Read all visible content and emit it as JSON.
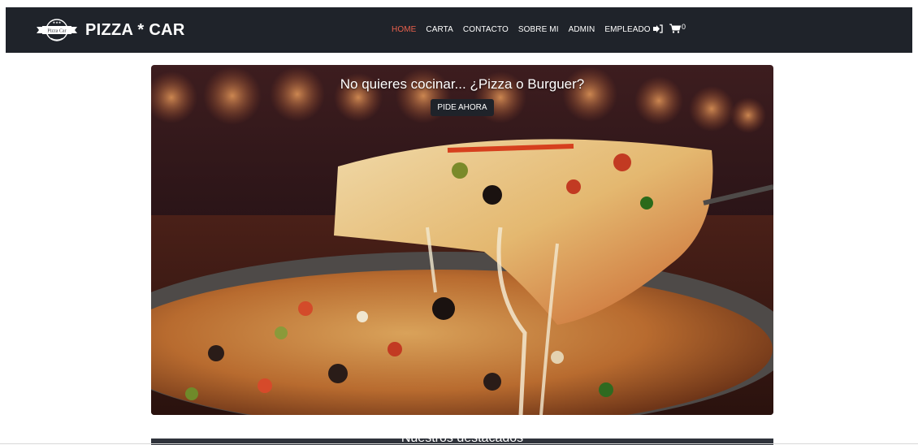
{
  "navbar": {
    "brand_name": "PIZZA * CAR",
    "logo_text": "Pizza Car",
    "links": [
      {
        "label": "HOME",
        "active": true
      },
      {
        "label": "CARTA",
        "active": false
      },
      {
        "label": "CONTACTO",
        "active": false
      },
      {
        "label": "SOBRE MI",
        "active": false
      },
      {
        "label": "ADMIN",
        "active": false
      },
      {
        "label": "EMPLEADO",
        "active": false
      }
    ],
    "cart_count": "0",
    "icons": [
      "sign-out-icon",
      "shopping-cart-icon"
    ]
  },
  "hero": {
    "title": "No quieres cocinar... ¿Pizza o Burguer?",
    "button_label": "PIDE AHORA"
  },
  "featured": {
    "title": "Nuestros destacados"
  },
  "colors": {
    "navbar_bg": "#1f232a",
    "active_link": "#e8604c",
    "button_bg": "#1f232a"
  }
}
